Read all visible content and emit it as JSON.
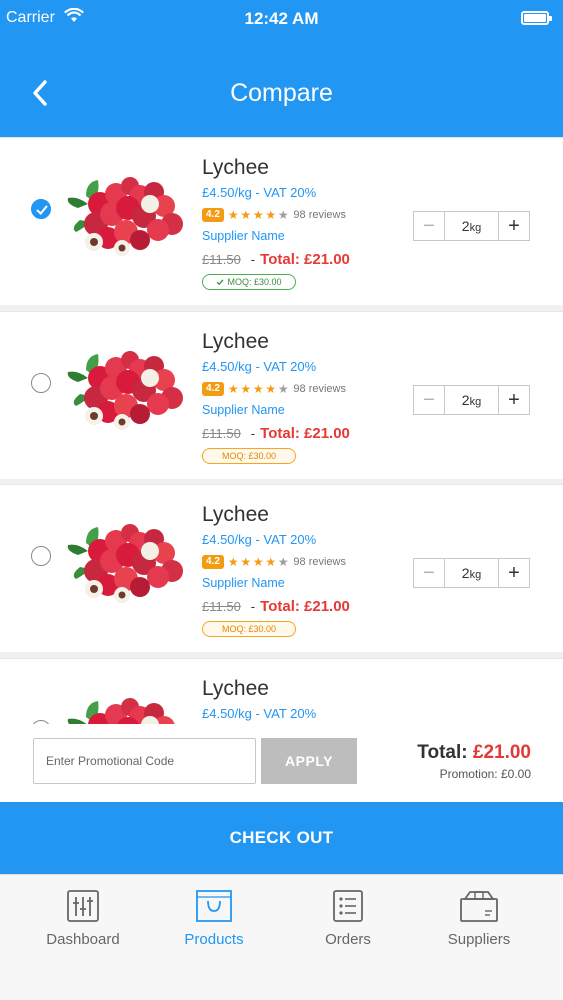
{
  "status_bar": {
    "carrier": "Carrier",
    "time": "12:42 AM"
  },
  "header": {
    "title": "Compare"
  },
  "products": [
    {
      "name": "Lychee",
      "price": "£4.50/kg - VAT 20%",
      "rating": "4.2",
      "stars_filled": 4,
      "reviews": "98 reviews",
      "supplier": "Supplier Name",
      "old_price": "£11.50",
      "separator": "-",
      "total": "Total: £21.00",
      "moq": "MOQ: £30.00",
      "moq_met": true,
      "selected": true,
      "qty_value": "2",
      "qty_unit": "kg",
      "minus": "−",
      "plus": "+"
    },
    {
      "name": "Lychee",
      "price": "£4.50/kg - VAT 20%",
      "rating": "4.2",
      "stars_filled": 4,
      "reviews": "98 reviews",
      "supplier": "Supplier Name",
      "old_price": "£11.50",
      "separator": "-",
      "total": "Total: £21.00",
      "moq": "MOQ: £30.00",
      "moq_met": false,
      "selected": false,
      "qty_value": "2",
      "qty_unit": "kg",
      "minus": "−",
      "plus": "+"
    },
    {
      "name": "Lychee",
      "price": "£4.50/kg - VAT 20%",
      "rating": "4.2",
      "stars_filled": 4,
      "reviews": "98 reviews",
      "supplier": "Supplier Name",
      "old_price": "£11.50",
      "separator": "-",
      "total": "Total: £21.00",
      "moq": "MOQ: £30.00",
      "moq_met": false,
      "selected": false,
      "qty_value": "2",
      "qty_unit": "kg",
      "minus": "−",
      "plus": "+"
    },
    {
      "name": "Lychee",
      "price": "£4.50/kg - VAT 20%",
      "selected": false
    }
  ],
  "summary": {
    "promo_placeholder": "Enter Promotional Code",
    "apply_label": "APPLY",
    "total_label": "Total:",
    "total_amount": "£21.00",
    "promotion": "Promotion: £0.00"
  },
  "checkout_label": "CHECK OUT",
  "tabs": [
    {
      "label": "Dashboard",
      "icon": "sliders-icon",
      "active": false
    },
    {
      "label": "Products",
      "icon": "shopping-bag-icon",
      "active": true
    },
    {
      "label": "Orders",
      "icon": "orders-list-icon",
      "active": false
    },
    {
      "label": "Suppliers",
      "icon": "box-icon",
      "active": false
    }
  ],
  "colors": {
    "primary": "#2196f3",
    "price_red": "#e53935",
    "rating": "#f39c12",
    "moq_ok": "#4caf50",
    "moq_warn": "#f5a623"
  }
}
